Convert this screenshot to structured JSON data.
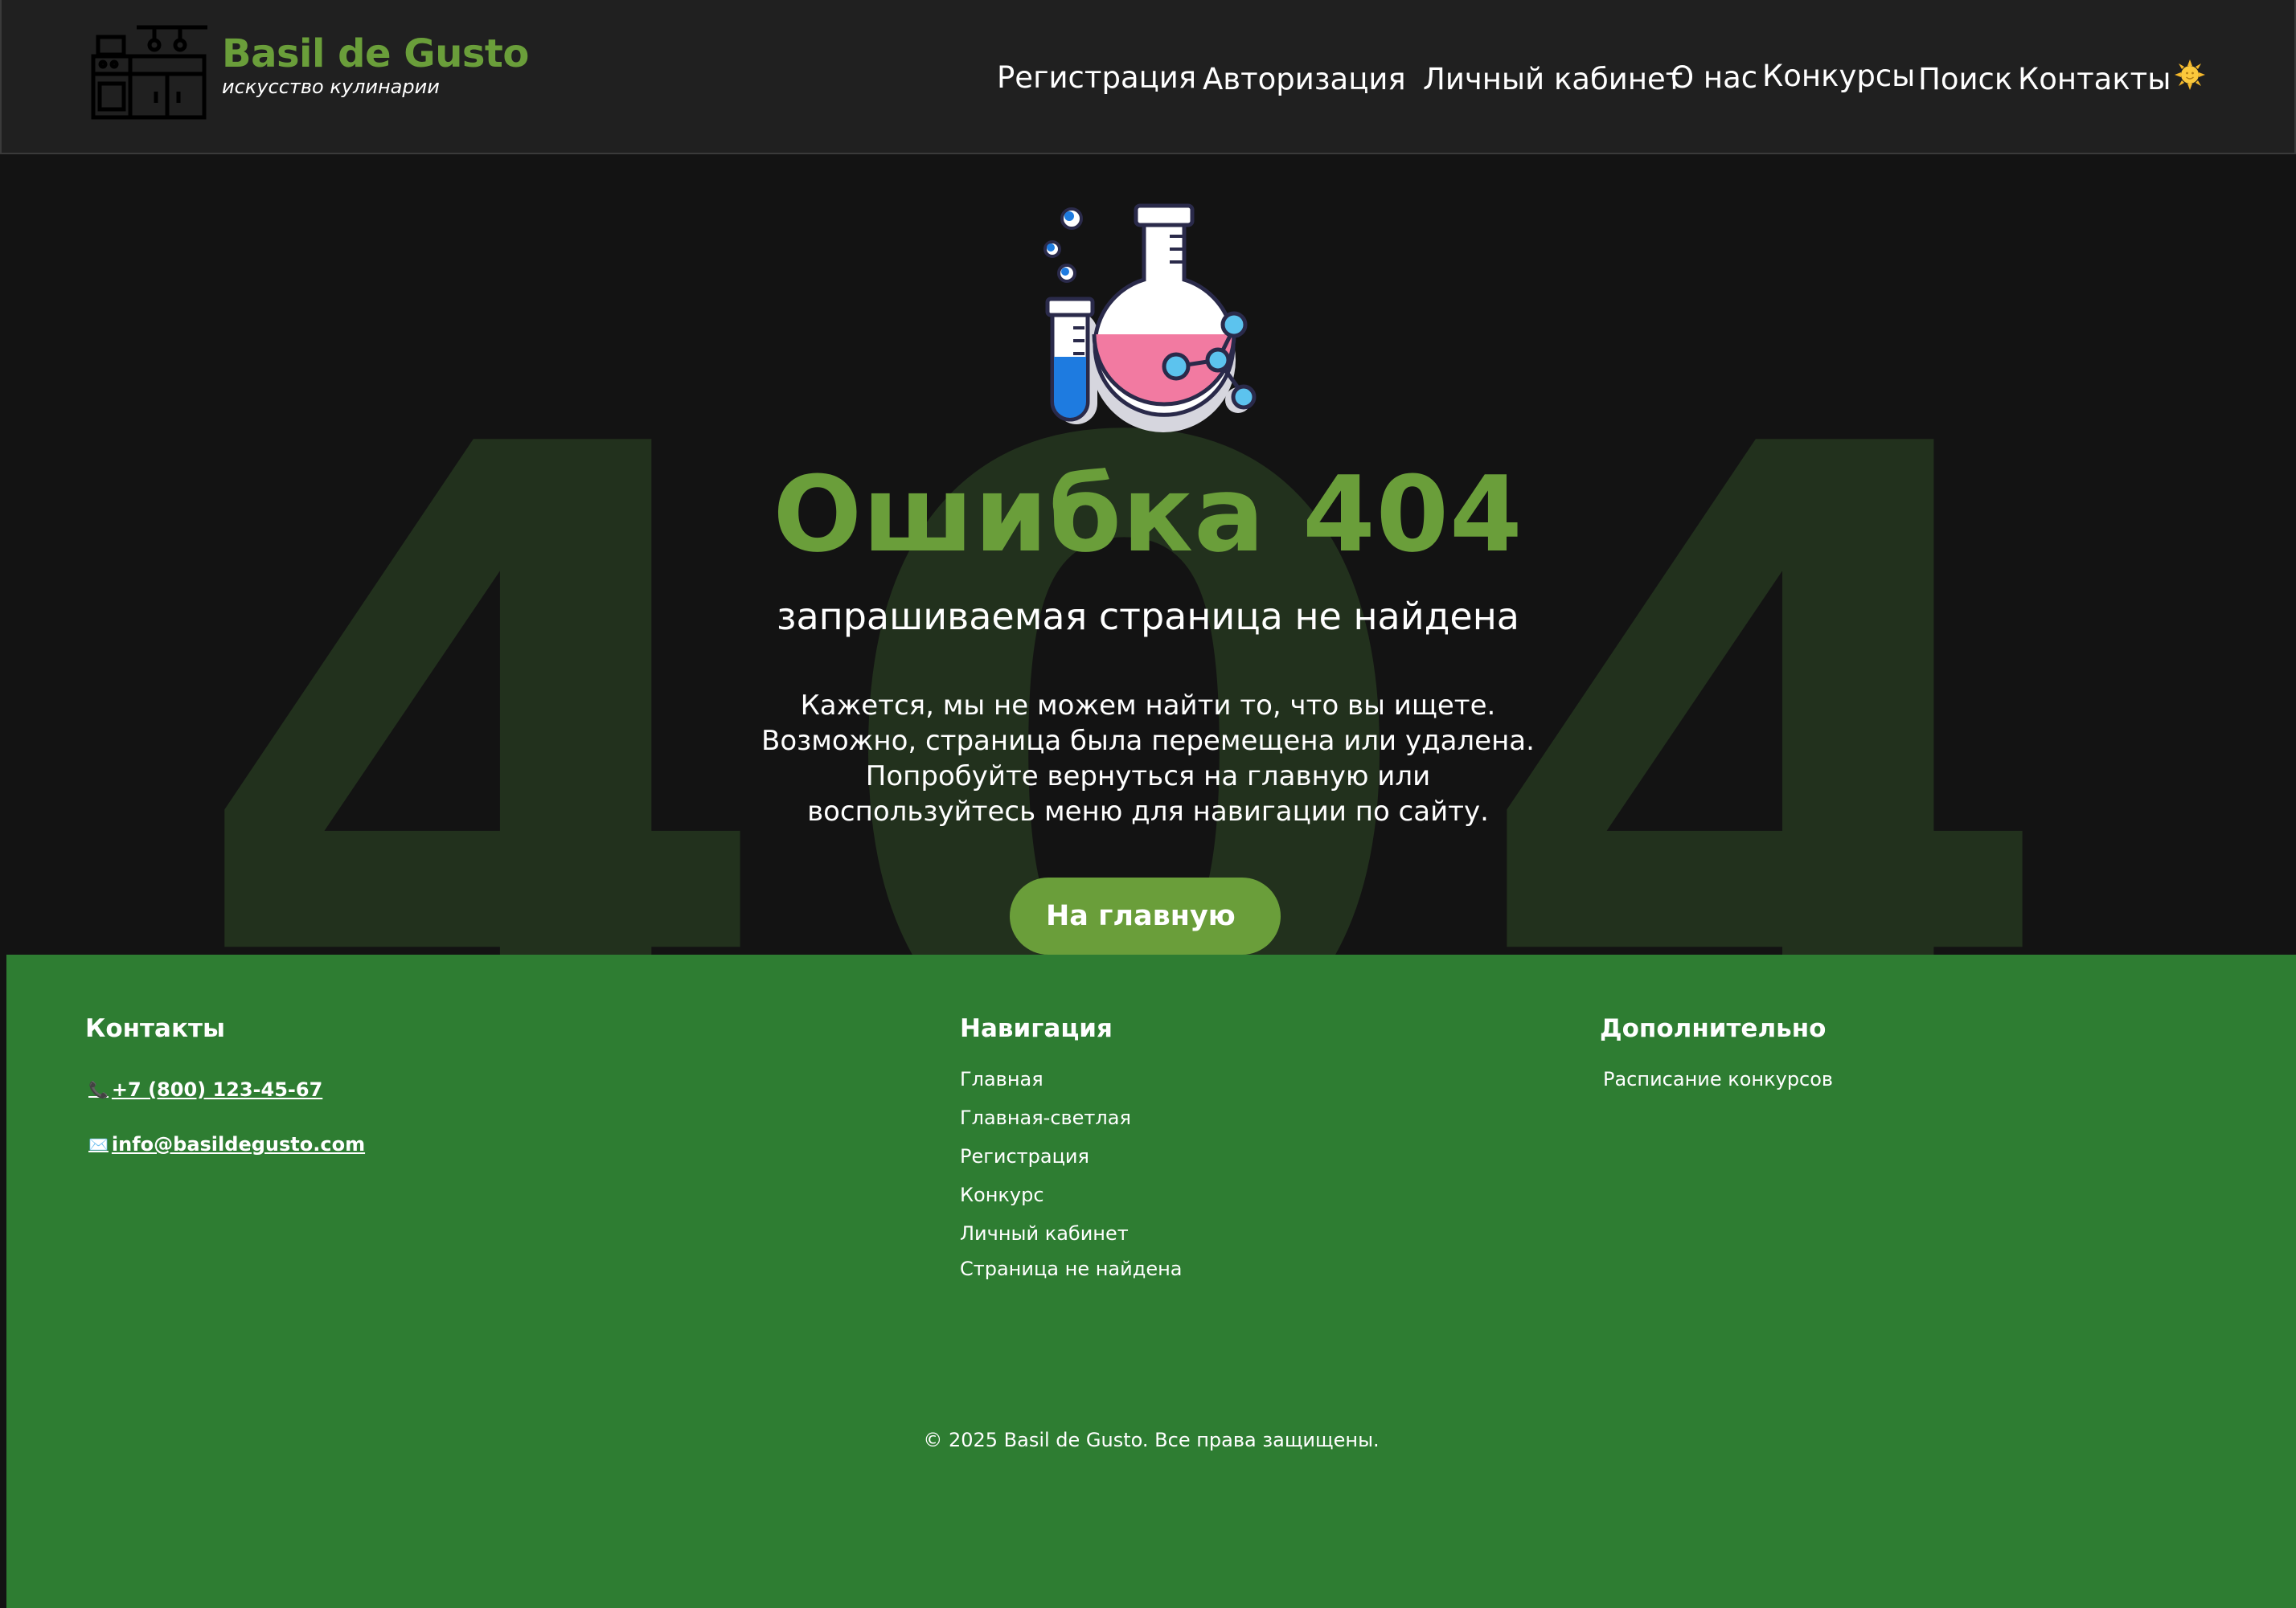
{
  "header": {
    "brand_title": "Basil de Gusto",
    "brand_subtitle": "искусство кулинарии",
    "nav": [
      "Регистрация",
      "Авторизация",
      "Личный кабинет",
      "О нас",
      "Конкурсы",
      "Поиск",
      "Контакты"
    ],
    "theme_icon": "sun-icon"
  },
  "hero": {
    "background_number": "404",
    "title": "Ошибка 404",
    "subtitle": "запрашиваемая страница не найдена",
    "description_lines": [
      "Кажется, мы не можем найти то, что вы ищете.",
      "Возможно, страница была перемещена или удалена.",
      "Попробуйте вернуться на главную или",
      "воспользуйтесь меню для навигации по сайту."
    ],
    "home_button": "На главную",
    "illustration_icon": "flask-icon"
  },
  "footer": {
    "contacts_title": "Контакты",
    "phone_icon": "📞",
    "phone": "+7 (800) 123-45-67",
    "email_icon": "✉️",
    "email": "info@basildegusto.com",
    "nav_title": "Навигация",
    "nav_links": [
      "Главная",
      "Главная-светлая",
      "Регистрация",
      "Конкурс",
      "Личный кабинет",
      "Страница не найдена"
    ],
    "extra_title": "Дополнительно",
    "extra_links": [
      "Расписание конкурсов"
    ],
    "copyright": "© 2025 Basil de Gusto. Все права защищены."
  },
  "colors": {
    "brand_green": "#6a9e3a",
    "footer_green": "#2e7d32",
    "header_bg": "#202020",
    "page_bg": "#131313",
    "bg_number": "#22311d"
  }
}
